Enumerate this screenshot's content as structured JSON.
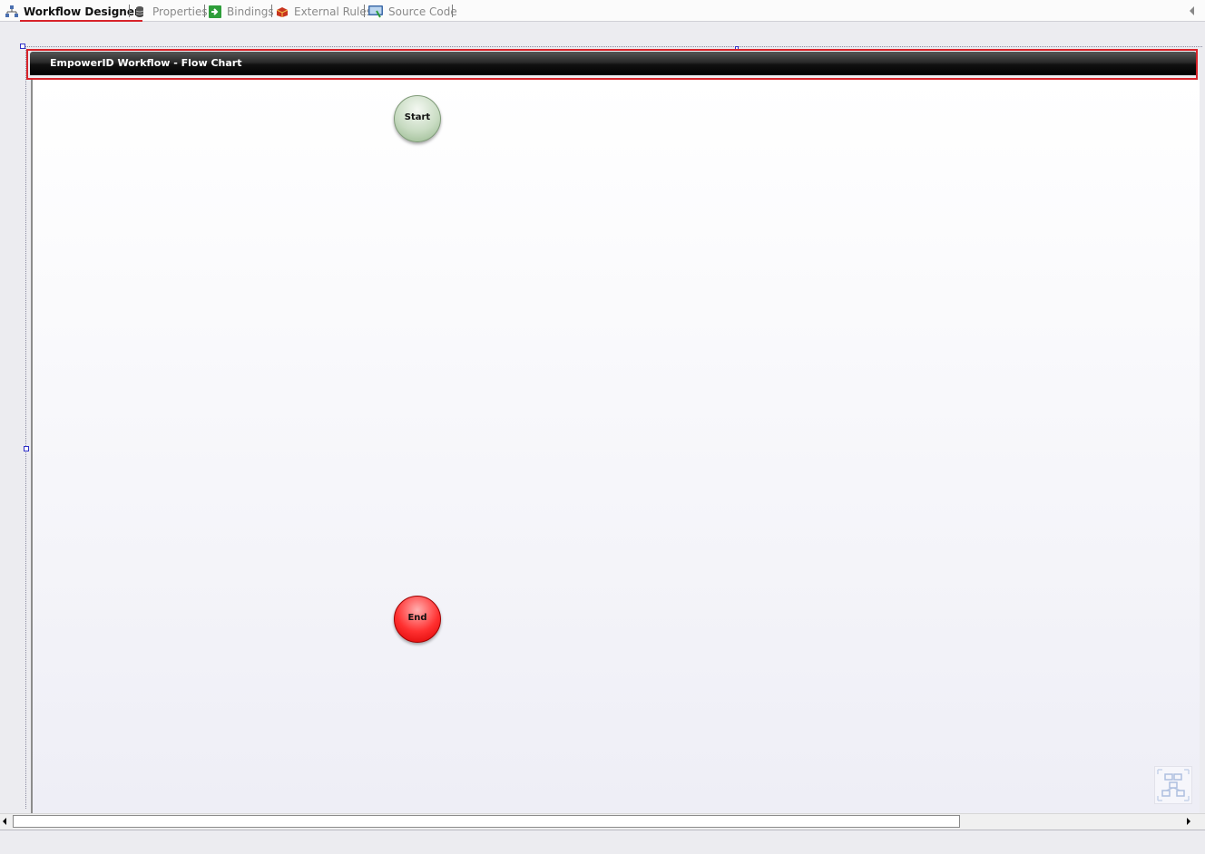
{
  "tabs": [
    {
      "label": "Workflow Designer",
      "icon": "workflow-diagram-icon",
      "active": true
    },
    {
      "label": "Properties",
      "icon": "database-icon",
      "active": false
    },
    {
      "label": "Bindings",
      "icon": "green-arrow-icon",
      "active": false
    },
    {
      "label": "External Rules",
      "icon": "red-cube-icon",
      "active": false
    },
    {
      "label": "Source Code",
      "icon": "monitor-icon",
      "active": false
    }
  ],
  "canvas": {
    "title": "EmpowerID Workflow - Flow Chart",
    "nodes": {
      "start": "Start",
      "end": "End"
    }
  },
  "colors": {
    "highlight": "#d8232a",
    "start_node": "#c9dcc3",
    "end_node": "#ff3030",
    "header_bar": "#111111"
  }
}
